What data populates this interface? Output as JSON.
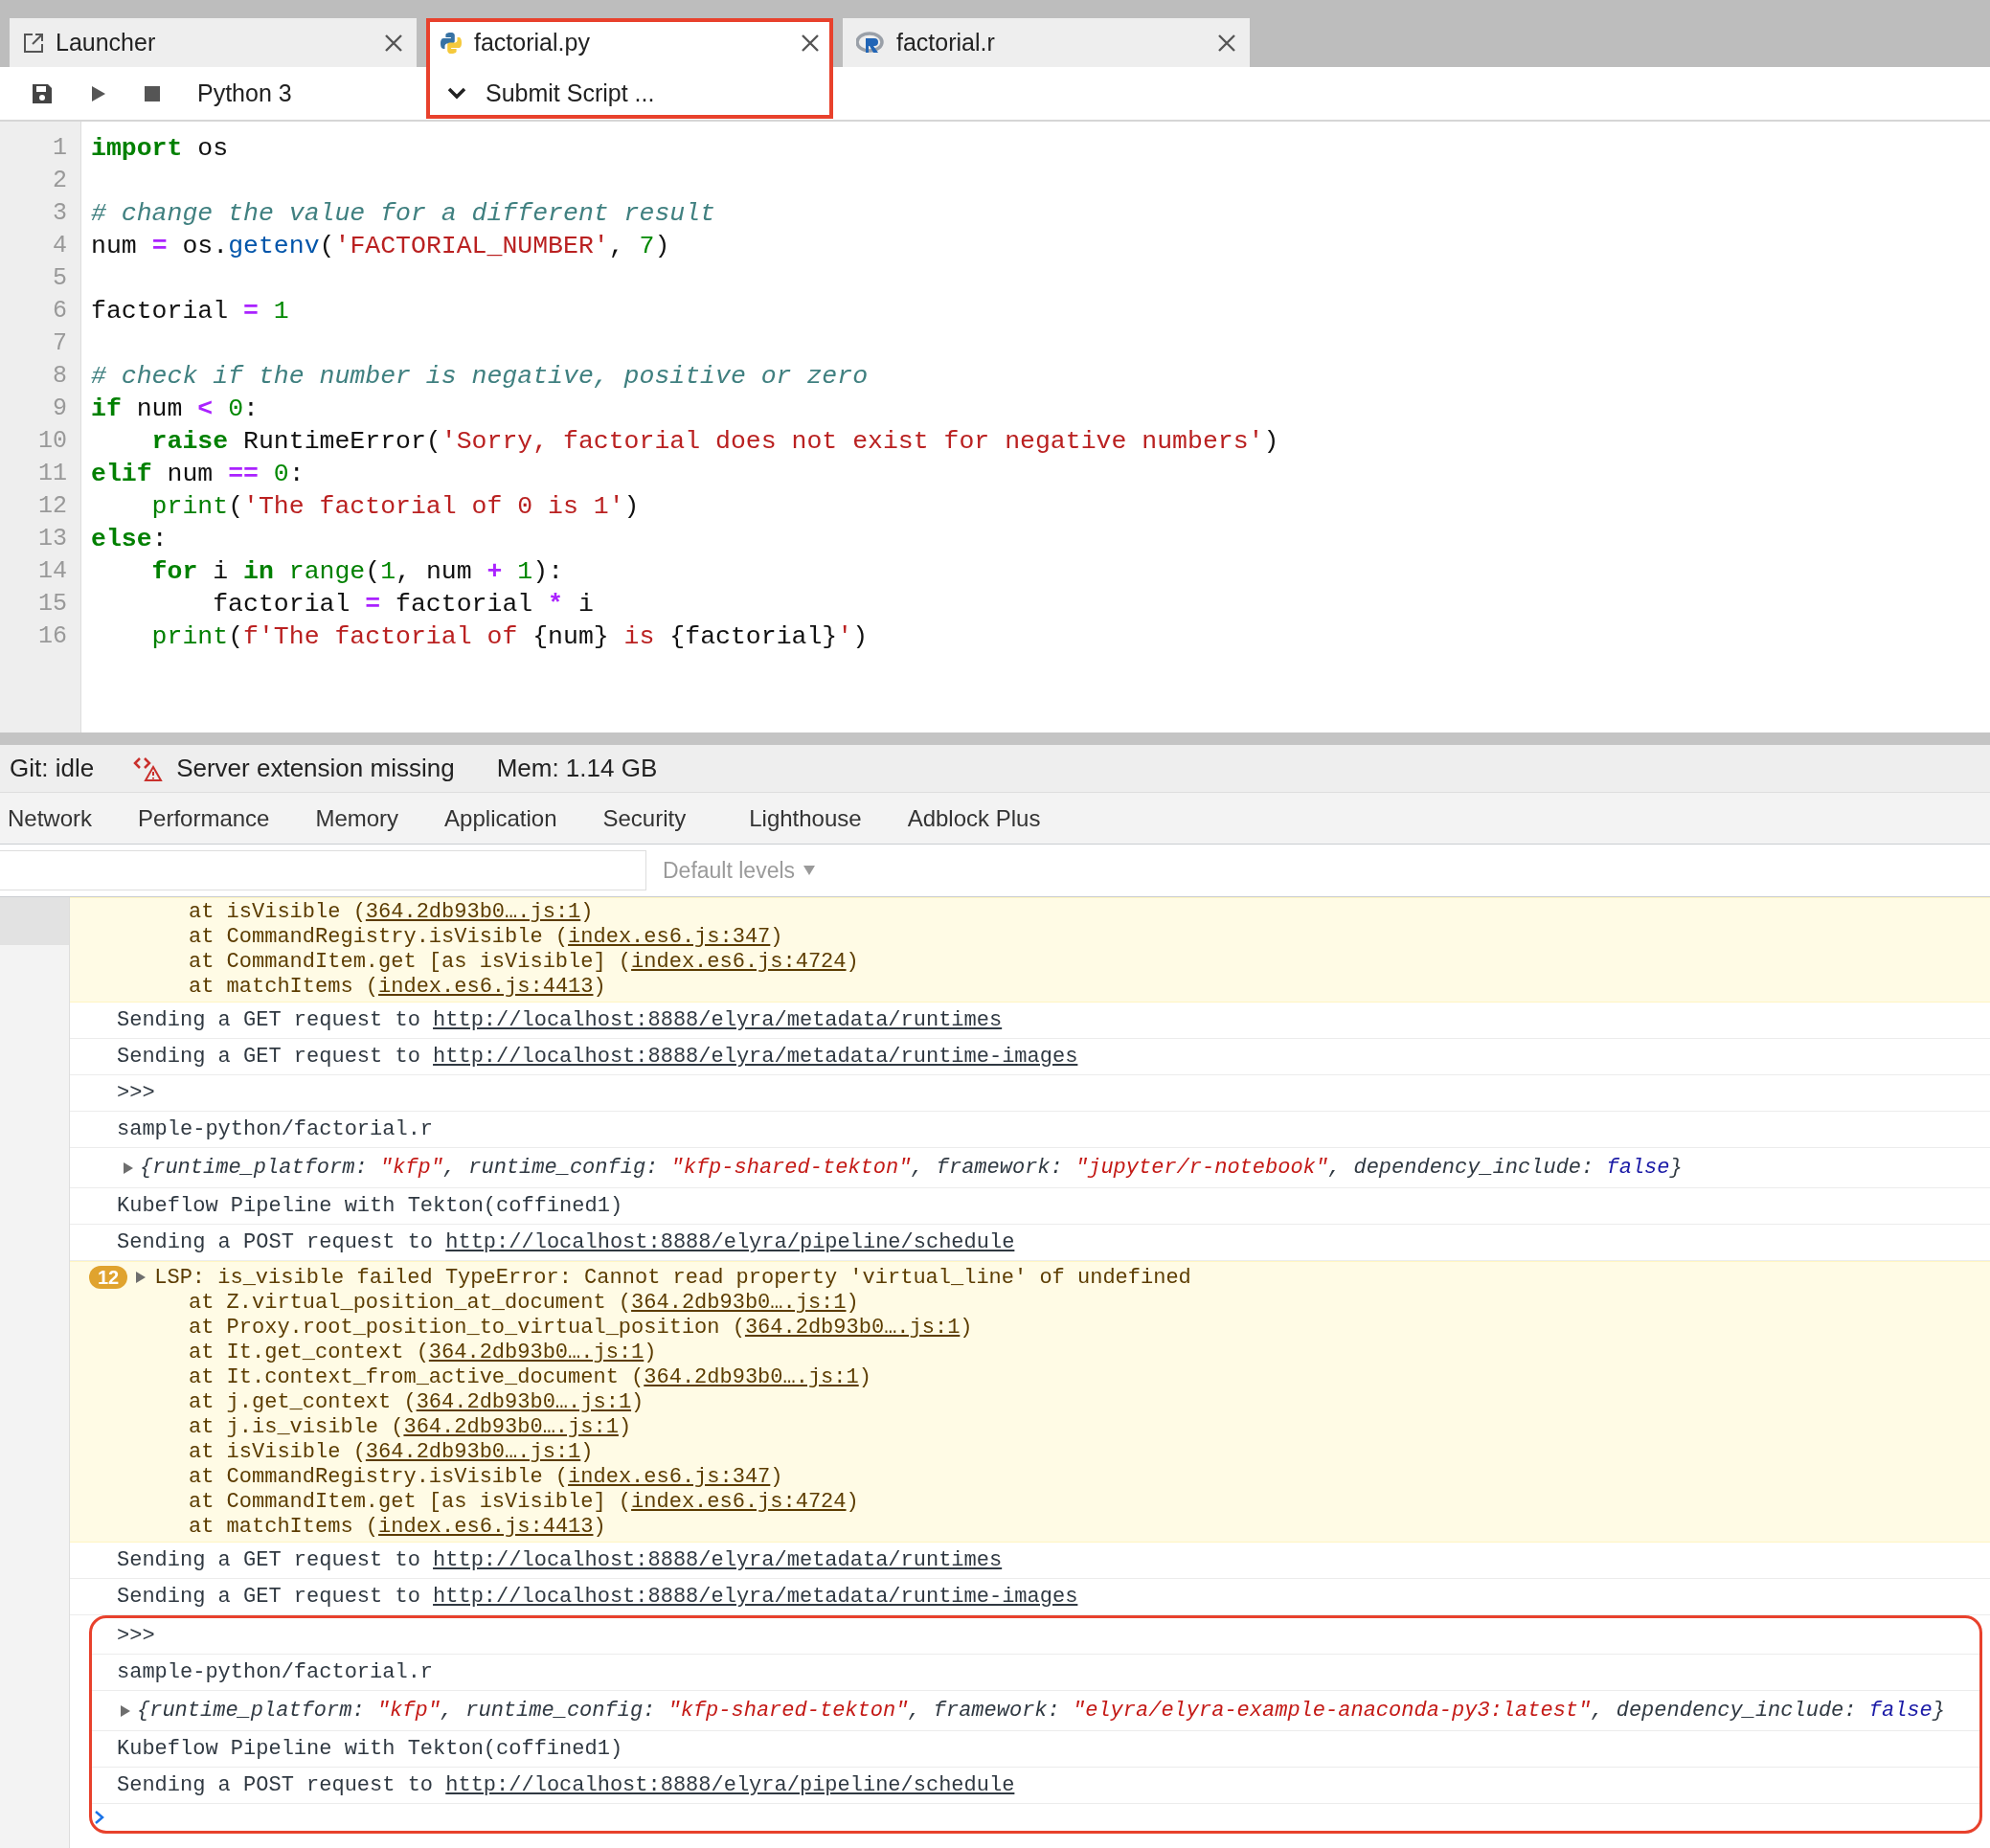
{
  "tabs": [
    {
      "label": "Launcher",
      "kind": "launcher",
      "selected": false,
      "highlighted": false
    },
    {
      "label": "factorial.py",
      "kind": "python",
      "selected": true,
      "highlighted": true
    },
    {
      "label": "factorial.r",
      "kind": "r",
      "selected": false,
      "highlighted": false
    }
  ],
  "toolbar": {
    "kernel": "Python 3",
    "submit_label": "Submit Script ..."
  },
  "editor": {
    "lines": [
      {
        "number": "1",
        "tokens": [
          {
            "text": "import",
            "kind": "keyword"
          },
          {
            "text": " os",
            "kind": "plain"
          }
        ]
      },
      {
        "number": "2"
      },
      {
        "number": "3",
        "tokens": [
          {
            "text": "# change the value for a different result",
            "kind": "comment"
          }
        ]
      },
      {
        "number": "4",
        "tokens": [
          {
            "text": "num ",
            "kind": "plain"
          },
          {
            "text": "=",
            "kind": "operator"
          },
          {
            "text": " os.",
            "kind": "plain"
          },
          {
            "text": "getenv",
            "kind": "property"
          },
          {
            "text": "(",
            "kind": "plain"
          },
          {
            "text": "'FACTORIAL_NUMBER'",
            "kind": "string"
          },
          {
            "text": ", ",
            "kind": "plain"
          },
          {
            "text": "7",
            "kind": "number"
          },
          {
            "text": ")",
            "kind": "plain"
          }
        ]
      },
      {
        "number": "5"
      },
      {
        "number": "6",
        "tokens": [
          {
            "text": "factorial ",
            "kind": "plain"
          },
          {
            "text": "=",
            "kind": "operator"
          },
          {
            "text": " 1",
            "kind": "number"
          }
        ]
      },
      {
        "number": "7"
      },
      {
        "number": "8",
        "tokens": [
          {
            "text": "# check if the number is negative, positive or zero",
            "kind": "comment"
          }
        ]
      },
      {
        "number": "9",
        "tokens": [
          {
            "text": "if",
            "kind": "keyword"
          },
          {
            "text": " num ",
            "kind": "plain"
          },
          {
            "text": "<",
            "kind": "operator"
          },
          {
            "text": " 0",
            "kind": "number"
          },
          {
            "text": ":",
            "kind": "plain"
          }
        ]
      },
      {
        "number": "10",
        "tokens": [
          {
            "text": "    raise",
            "kind": "keyword"
          },
          {
            "text": " RuntimeError(",
            "kind": "plain"
          },
          {
            "text": "'Sorry, factorial does not exist for negative numbers'",
            "kind": "string"
          },
          {
            "text": ")",
            "kind": "plain"
          }
        ]
      },
      {
        "number": "11",
        "tokens": [
          {
            "text": "elif",
            "kind": "keyword"
          },
          {
            "text": " num ",
            "kind": "plain"
          },
          {
            "text": "==",
            "kind": "operator"
          },
          {
            "text": " 0",
            "kind": "number"
          },
          {
            "text": ":",
            "kind": "plain"
          }
        ]
      },
      {
        "number": "12",
        "tokens": [
          {
            "text": "    print",
            "kind": "builtin"
          },
          {
            "text": "(",
            "kind": "plain"
          },
          {
            "text": "'The factorial of 0 is 1'",
            "kind": "string"
          },
          {
            "text": ")",
            "kind": "plain"
          }
        ]
      },
      {
        "number": "13",
        "tokens": [
          {
            "text": "else",
            "kind": "keyword"
          },
          {
            "text": ":",
            "kind": "plain"
          }
        ]
      },
      {
        "number": "14",
        "tokens": [
          {
            "text": "    for",
            "kind": "keyword"
          },
          {
            "text": " i ",
            "kind": "plain"
          },
          {
            "text": "in",
            "kind": "keyword"
          },
          {
            "text": " range",
            "kind": "builtin"
          },
          {
            "text": "(",
            "kind": "plain"
          },
          {
            "text": "1",
            "kind": "number"
          },
          {
            "text": ", num ",
            "kind": "plain"
          },
          {
            "text": "+",
            "kind": "operator"
          },
          {
            "text": " 1",
            "kind": "number"
          },
          {
            "text": "):",
            "kind": "plain"
          }
        ]
      },
      {
        "number": "15",
        "tokens": [
          {
            "text": "        factorial ",
            "kind": "plain"
          },
          {
            "text": "=",
            "kind": "operator"
          },
          {
            "text": " factorial ",
            "kind": "plain"
          },
          {
            "text": "*",
            "kind": "operator"
          },
          {
            "text": " i",
            "kind": "plain"
          }
        ]
      },
      {
        "number": "16",
        "tokens": [
          {
            "text": "    print",
            "kind": "builtin"
          },
          {
            "text": "(",
            "kind": "plain"
          },
          {
            "text": "f'The factorial of ",
            "kind": "string"
          },
          {
            "text": "{num}",
            "kind": "plain"
          },
          {
            "text": " is ",
            "kind": "string"
          },
          {
            "text": "{factorial}",
            "kind": "plain"
          },
          {
            "text": "'",
            "kind": "string"
          },
          {
            "text": ")",
            "kind": "plain"
          }
        ]
      }
    ]
  },
  "status_bar": {
    "git": "Git: idle",
    "extension": "Server extension missing",
    "memory": "Mem: 1.14 GB"
  },
  "devtools_tabs": [
    "Network",
    "Performance",
    "Memory",
    "Application",
    "Security",
    "Lighthouse",
    "Adblock Plus"
  ],
  "console_filter": {
    "levels": "Default levels"
  },
  "console": [
    {
      "kind": "warning",
      "trace": [
        {
          "prefix": "at isVisible (",
          "link": "364.2db93b0….js:1",
          "suffix": ")"
        },
        {
          "prefix": "at CommandRegistry.isVisible (",
          "link": "index.es6.js:347",
          "suffix": ")"
        },
        {
          "prefix": "at CommandItem.get [as isVisible] (",
          "link": "index.es6.js:4724",
          "suffix": ")"
        },
        {
          "prefix": "at matchItems (",
          "link": "index.es6.js:4413",
          "suffix": ")"
        }
      ]
    },
    {
      "kind": "log",
      "text": "Sending a GET request to ",
      "link": "http://localhost:8888/elyra/metadata/runtimes"
    },
    {
      "kind": "log",
      "text": "Sending a GET request to ",
      "link": "http://localhost:8888/elyra/metadata/runtime-images"
    },
    {
      "kind": "log",
      "text": ">>>"
    },
    {
      "kind": "log",
      "text": "sample-python/factorial.r"
    },
    {
      "kind": "object",
      "expanded": false,
      "tokens": [
        {
          "text": "{runtime_platform: ",
          "kind": "key"
        },
        {
          "text": "\"kfp\"",
          "kind": "string"
        },
        {
          "text": ", runtime_config: ",
          "kind": "key"
        },
        {
          "text": "\"kfp-shared-tekton\"",
          "kind": "string"
        },
        {
          "text": ", framework: ",
          "kind": "key"
        },
        {
          "text": "\"jupyter/r-notebook\"",
          "kind": "string"
        },
        {
          "text": ", dependency_include: ",
          "kind": "key"
        },
        {
          "text": "false",
          "kind": "boolean"
        },
        {
          "text": "}",
          "kind": "key"
        }
      ]
    },
    {
      "kind": "log",
      "text": "Kubeflow Pipeline with Tekton(coffined1)"
    },
    {
      "kind": "log",
      "text": "Sending a POST request to ",
      "link": "http://localhost:8888/elyra/pipeline/schedule"
    },
    {
      "kind": "warning",
      "count": "12",
      "expanded": false,
      "message": "LSP: is_visible failed TypeError: Cannot read property 'virtual_line' of undefined",
      "trace": [
        {
          "prefix": "at Z.virtual_position_at_document (",
          "link": "364.2db93b0….js:1",
          "suffix": ")"
        },
        {
          "prefix": "at Proxy.root_position_to_virtual_position (",
          "link": "364.2db93b0….js:1",
          "suffix": ")"
        },
        {
          "prefix": "at It.get_context (",
          "link": "364.2db93b0….js:1",
          "suffix": ")"
        },
        {
          "prefix": "at It.context_from_active_document (",
          "link": "364.2db93b0….js:1",
          "suffix": ")"
        },
        {
          "prefix": "at j.get_context (",
          "link": "364.2db93b0….js:1",
          "suffix": ")"
        },
        {
          "prefix": "at j.is_visible (",
          "link": "364.2db93b0….js:1",
          "suffix": ")"
        },
        {
          "prefix": "at isVisible (",
          "link": "364.2db93b0….js:1",
          "suffix": ")"
        },
        {
          "prefix": "at CommandRegistry.isVisible (",
          "link": "index.es6.js:347",
          "suffix": ")"
        },
        {
          "prefix": "at CommandItem.get [as isVisible] (",
          "link": "index.es6.js:4724",
          "suffix": ")"
        },
        {
          "prefix": "at matchItems (",
          "link": "index.es6.js:4413",
          "suffix": ")"
        }
      ]
    },
    {
      "kind": "log",
      "text": "Sending a GET request to ",
      "link": "http://localhost:8888/elyra/metadata/runtimes"
    },
    {
      "kind": "log",
      "text": "Sending a GET request to ",
      "link": "http://localhost:8888/elyra/metadata/runtime-images"
    },
    {
      "kind": "group",
      "highlighted": true,
      "entries": [
        {
          "kind": "log",
          "text": ">>>"
        },
        {
          "kind": "log",
          "text": "sample-python/factorial.r"
        },
        {
          "kind": "object",
          "expanded": false,
          "tokens": [
            {
              "text": "{runtime_platform: ",
              "kind": "key"
            },
            {
              "text": "\"kfp\"",
              "kind": "string"
            },
            {
              "text": ", runtime_config: ",
              "kind": "key"
            },
            {
              "text": "\"kfp-shared-tekton\"",
              "kind": "string"
            },
            {
              "text": ", framework: ",
              "kind": "key"
            },
            {
              "text": "\"elyra/elyra-example-anaconda-py3:latest\"",
              "kind": "string"
            },
            {
              "text": ", dependency_include: ",
              "kind": "key"
            },
            {
              "text": "false",
              "kind": "boolean"
            },
            {
              "text": "}",
              "kind": "key"
            }
          ]
        },
        {
          "kind": "log",
          "text": "Kubeflow Pipeline with Tekton(coffined1)"
        },
        {
          "kind": "log",
          "text": "Sending a POST request to ",
          "link": "http://localhost:8888/elyra/pipeline/schedule"
        },
        {
          "kind": "prompt"
        }
      ]
    }
  ]
}
